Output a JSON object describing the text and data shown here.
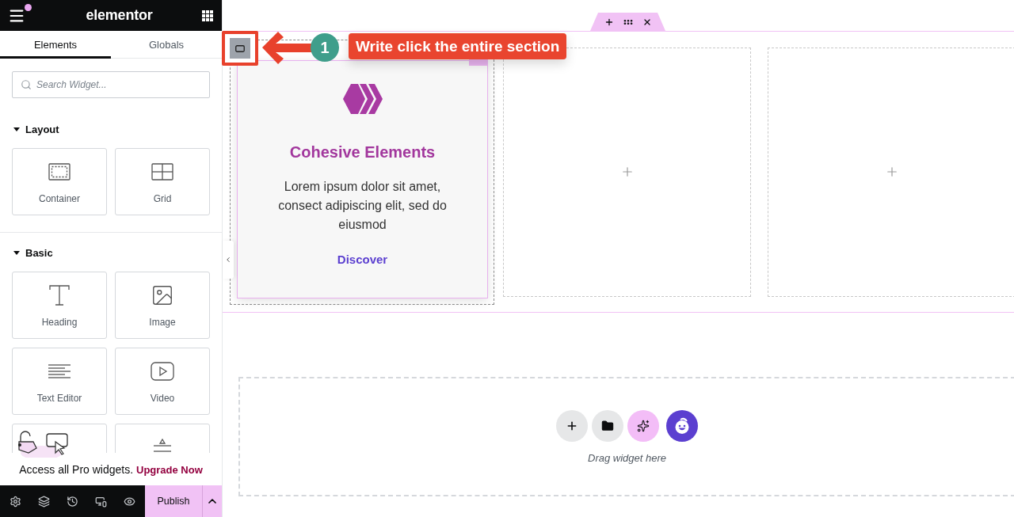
{
  "panel": {
    "header": {
      "logo": "elementor",
      "notification": true
    },
    "tabs": [
      {
        "label": "Elements",
        "selected": true
      },
      {
        "label": "Globals",
        "selected": false
      }
    ],
    "search": {
      "placeholder": "Search Widget..."
    },
    "categories": [
      {
        "title": "Layout",
        "expanded": true,
        "widgets": [
          {
            "kind": "container",
            "label": "Container"
          },
          {
            "kind": "grid",
            "label": "Grid"
          }
        ]
      },
      {
        "title": "Basic",
        "expanded": true,
        "widgets": [
          {
            "kind": "heading",
            "label": "Heading"
          },
          {
            "kind": "image",
            "label": "Image"
          },
          {
            "kind": "text-editor",
            "label": "Text Editor"
          },
          {
            "kind": "video",
            "label": "Video"
          },
          {
            "kind": "covered"
          },
          {
            "kind": "divider"
          }
        ]
      }
    ],
    "promo": {
      "text": "Access all Pro widgets.",
      "link": "Upgrade Now"
    },
    "footer": {
      "publish": "Publish"
    }
  },
  "canvas": {
    "columns": [
      {
        "kind": "card",
        "title": "Cohesive Elements",
        "text": "Lorem ipsum dolor sit amet, consect adipiscing elit, sed do eiusmod",
        "link": "Discover"
      },
      {
        "kind": "empty"
      },
      {
        "kind": "empty"
      }
    ],
    "annotation": {
      "step": "1",
      "text": "Write click the entire section"
    },
    "drop_zone": {
      "hint": "Drag widget here"
    }
  }
}
